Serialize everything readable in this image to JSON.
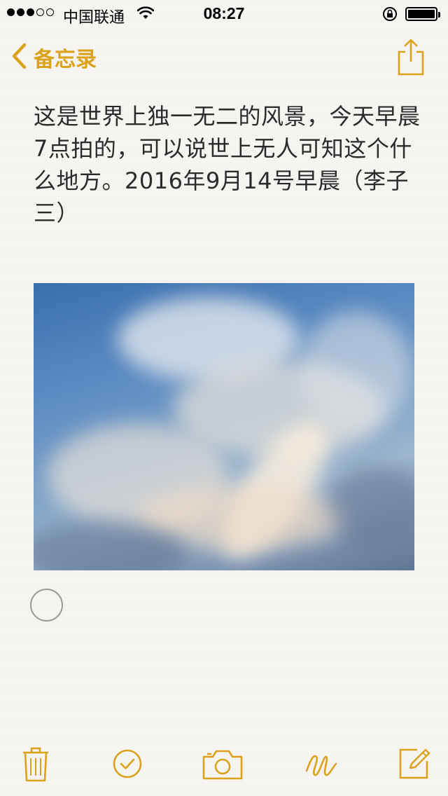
{
  "status_bar": {
    "carrier": "中国联通",
    "time": "08:27",
    "signal_bars_filled": 3,
    "signal_bars_total": 5,
    "battery_level": 1.0
  },
  "nav": {
    "back_label": "备忘录",
    "accent_color": "#dba21b",
    "back_icon": "chevron-left-icon",
    "share_icon": "share-icon"
  },
  "note": {
    "text": "这是世界上独一无二的风景，今天早晨7点拍的，可以说世上无人可知这个什么地方。2016年9月14号早晨（李子三）",
    "image_description_icon": "photo-attachment"
  },
  "toolbar": {
    "items": [
      "trash-icon",
      "checklist-icon",
      "camera-icon",
      "sketch-icon",
      "compose-icon"
    ]
  }
}
